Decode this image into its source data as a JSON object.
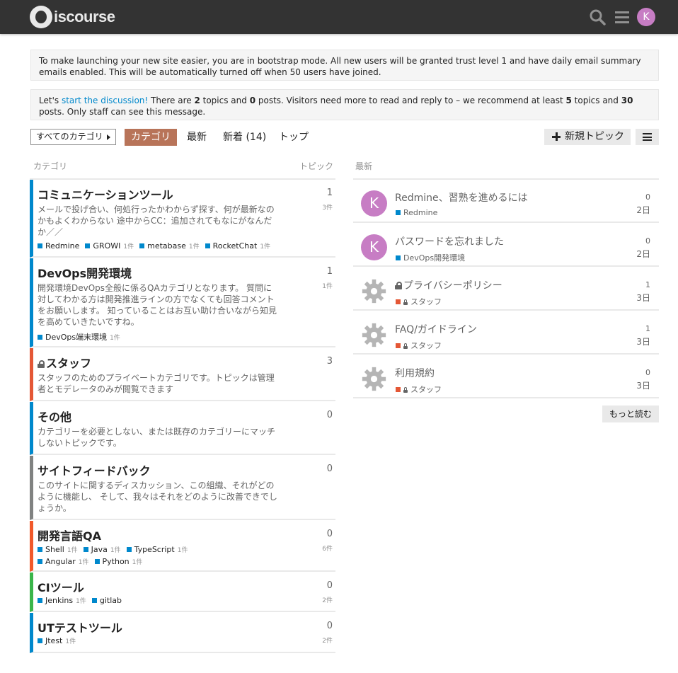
{
  "header": {
    "logo_text": "iscourse",
    "avatar_letter": "K",
    "search_icon": "search-icon",
    "menu_icon": "hamburger-icon"
  },
  "notices": {
    "bootstrap": "To make launching your new site easier, you are in bootstrap mode. All new users will be granted trust level 1 and have daily email summary emails enabled. This will be automatically turned off when 50 users have joined.",
    "discussion_prefix": "Let's ",
    "discussion_link": "start the discussion!",
    "discussion_t1": " There are ",
    "topics_count": "2",
    "discussion_t2": " topics and ",
    "posts_count": "0",
    "discussion_t3": " posts. Visitors need more to read and reply to – we recommend at least ",
    "rec_topics": "5",
    "discussion_t4": " topics and ",
    "rec_posts": "30",
    "discussion_t5": " posts. Only staff can see this message."
  },
  "nav": {
    "category_dropdown": "すべてのカテゴリ",
    "tabs": [
      "カテゴリ",
      "最新",
      "新着 (14)",
      "トップ"
    ],
    "new_topic": "新規トピック"
  },
  "columns": {
    "category": "カテゴリ",
    "topics": "トピック",
    "latest": "最新"
  },
  "categories": [
    {
      "name": "コミュニケーションツール",
      "desc": "メールで投げ合い、何処行ったかわからず探す、何が最新なのかもよくわからない 途中からCC：追加されてもなにがなんだか／／",
      "count": "1",
      "sub_count": "3件",
      "color": "#0088cc",
      "subcats": [
        {
          "name": "Redmine",
          "count": ""
        },
        {
          "name": "GROWI",
          "count": "1件"
        },
        {
          "name": "metabase",
          "count": "1件"
        },
        {
          "name": "RocketChat",
          "count": "1件"
        }
      ]
    },
    {
      "name": "DevOps開発環境",
      "desc": "開発環境DevOps全般に係るQAカテゴリとなります。 質問に対してわかる方は開発推進ラインの方でなくても回答コメントをお願いします。 知っていることはお互い助け合いながら知見を高めていきたいですね。",
      "count": "1",
      "sub_count": "1件",
      "color": "#0088cc",
      "subcats": [
        {
          "name": "DevOps端末環境",
          "count": "1件"
        }
      ]
    },
    {
      "name": "スタッフ",
      "desc": "スタッフのためのプライベートカテゴリです。トピックは管理者とモデレータのみが閲覧できます",
      "count": "3",
      "sub_count": "",
      "color": "#e45735",
      "subcats": []
    },
    {
      "name": "その他",
      "desc": "カテゴリーを必要としない、または既存のカテゴリーにマッチしないトピックです。",
      "count": "0",
      "sub_count": "",
      "color": "#0088cc",
      "subcats": []
    },
    {
      "name": "サイトフィードバック",
      "desc": "このサイトに関するディスカッション、この組織、それがどのように機能し、 そして、我々はそれをどのように改善できでしょうか。",
      "count": "0",
      "sub_count": "",
      "color": "#808281",
      "subcats": []
    },
    {
      "name": "開発言語QA",
      "desc": "",
      "count": "0",
      "sub_count": "6件",
      "color": "#f1592a",
      "subcats": [
        {
          "name": "Shell",
          "count": "1件"
        },
        {
          "name": "Java",
          "count": "1件"
        },
        {
          "name": "TypeScript",
          "count": "1件"
        },
        {
          "name": "Angular",
          "count": "1件"
        },
        {
          "name": "Python",
          "count": "1件"
        }
      ]
    },
    {
      "name": "CIツール",
      "desc": "",
      "count": "0",
      "sub_count": "2件",
      "color": "#3ab54a",
      "subcats": [
        {
          "name": "Jenkins",
          "count": "1件"
        },
        {
          "name": "gitlab",
          "count": ""
        }
      ]
    },
    {
      "name": "UTテストツール",
      "desc": "",
      "count": "0",
      "sub_count": "2件",
      "color": "#0088cc",
      "subcats": [
        {
          "name": "Jtest",
          "count": "1件"
        }
      ]
    }
  ],
  "latest": [
    {
      "title": "Redmine、習熟を進めるには",
      "category": "Redmine",
      "locked_cat": false,
      "locked_title": false,
      "replies": "0",
      "age": "2日",
      "avatar": "K",
      "cat_color": "#0088cc"
    },
    {
      "title": "パスワードを忘れました",
      "category": "DevOps開発環境",
      "locked_cat": false,
      "locked_title": false,
      "replies": "0",
      "age": "2日",
      "avatar": "K",
      "cat_color": "#0088cc"
    },
    {
      "title": "プライバシーポリシー",
      "category": "スタッフ",
      "locked_cat": true,
      "locked_title": true,
      "replies": "1",
      "age": "3日",
      "avatar": "",
      "cat_color": "#e45735"
    },
    {
      "title": "FAQ/ガイドライン",
      "category": "スタッフ",
      "locked_cat": true,
      "locked_title": false,
      "replies": "1",
      "age": "3日",
      "avatar": "",
      "cat_color": "#e45735"
    },
    {
      "title": "利用規約",
      "category": "スタッフ",
      "locked_cat": true,
      "locked_title": false,
      "replies": "0",
      "age": "3日",
      "avatar": "",
      "cat_color": "#e45735"
    }
  ],
  "more_button": "もっと読む"
}
